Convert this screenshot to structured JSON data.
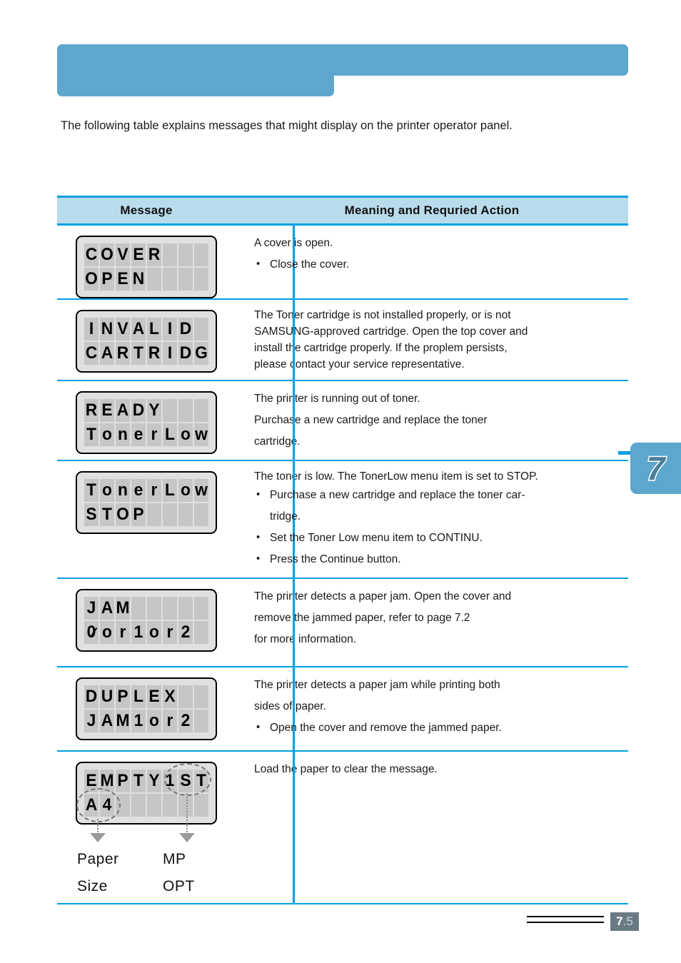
{
  "header": {
    "banner_title": "",
    "banner_color": "#5da7cf"
  },
  "intro": "The following table explains messages that might display on the printer operator panel.",
  "table": {
    "header_bg": "#b9dced",
    "rule_color": "#00a0e0",
    "columns": [
      "Message",
      "Meaning and Requried Action"
    ],
    "rows": [
      {
        "lcd": {
          "line1": "COVER",
          "line2": "OPEN",
          "cells": 8
        },
        "text_lines": [
          "A cover is open."
        ],
        "bullets": [
          "Close the cover."
        ]
      },
      {
        "lcd": {
          "line1": "INVALID",
          "line2": "CARTRIDG",
          "cells": 8
        },
        "text_lines": [
          "The Toner cartridge is not installed properly, or is not",
          "SAMSUNG-approved cartridge. Open the top cover and",
          "install the cartridge properly. If the proplem persists,",
          "please contact your service representative."
        ],
        "bullets": []
      },
      {
        "lcd": {
          "line1": "READY",
          "line2": "TonerLow",
          "cells": 8
        },
        "text_lines": [
          "The printer is running out of toner.",
          "Purchase a new cartridge and replace the toner",
          "cartridge."
        ],
        "bullets": []
      },
      {
        "lcd": {
          "line1": "TonerLow",
          "line2": "STOP",
          "cells": 8
        },
        "text_lines": [
          "The toner is low. The TonerLow menu item is set to STOP."
        ],
        "bullets": [
          "Purchase a new cartridge and replace the toner car-\ntridge.",
          "Set the Toner Low menu item to CONTINU.",
          "Press the Continue button."
        ]
      },
      {
        "lcd": {
          "line1": "JAM",
          "line2": "0or1or2",
          "cells": 8
        },
        "text_lines": [
          "The printer detects a paper jam. Open the cover and",
          "remove the jammed paper, refer to page 7.2",
          "for more information."
        ],
        "bullets": []
      },
      {
        "lcd": {
          "line1": "DUPLEX",
          "line2": "JAM1or2",
          "cells": 8
        },
        "text_lines": [
          "The printer detects a paper jam while printing both",
          "sides of paper."
        ],
        "bullets": [
          "Open the cover and remove the jammed paper."
        ]
      },
      {
        "lcd": {
          "line1": "EMPTY1ST",
          "line2": "A4",
          "cells": 8
        },
        "text_lines": [
          "Load the paper to clear the message."
        ],
        "bullets": [],
        "callouts": [
          {
            "label": "Paper\nSize",
            "target": "A4"
          },
          {
            "label": "MP\nOPT",
            "target": "1ST"
          }
        ]
      }
    ]
  },
  "chapter_tab": {
    "number": "7",
    "color": "#5da7cf"
  },
  "footer": {
    "page_major": "7",
    "page_minor": ".5"
  }
}
